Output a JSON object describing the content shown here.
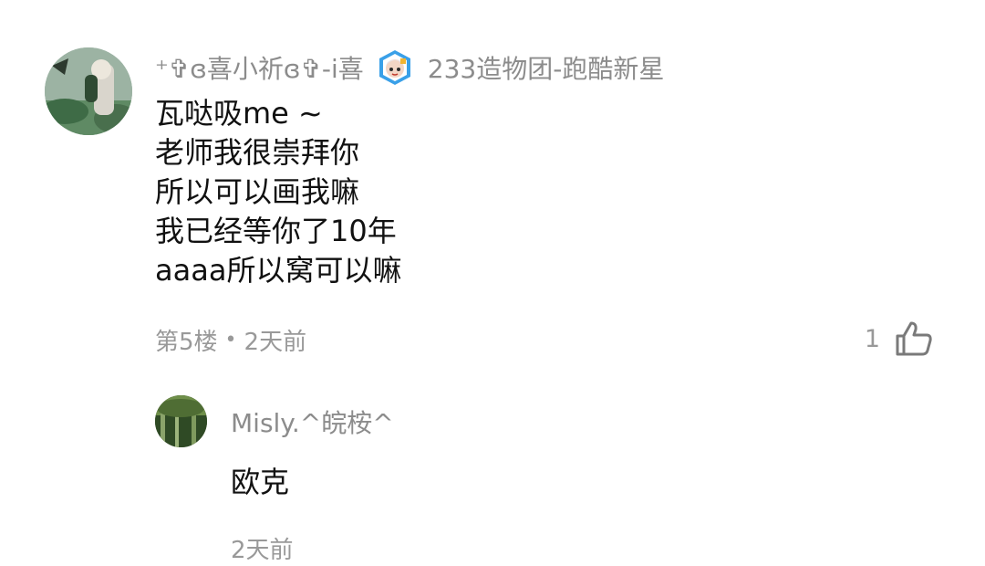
{
  "comment": {
    "user": {
      "name": "⁺✞ɞ喜小祈ɞ✞-i喜",
      "badge_icon": "team-badge-icon",
      "team": "233造物团-跑酷新星"
    },
    "lines": [
      "瓦哒吸me ~",
      "老师我很崇拜你",
      "所以可以画我嘛",
      "我已经等你了10年",
      "aaaa所以窝可以嘛"
    ],
    "floor": "第5楼",
    "separator": "•",
    "time": "2天前",
    "likes": "1",
    "like_icon": "thumbs-up-icon"
  },
  "reply": {
    "user": {
      "name": "Misly.^皖桉^"
    },
    "text": "欧克",
    "time": "2天前"
  },
  "colors": {
    "secondary_text": "#999999",
    "primary_text": "#111111",
    "badge_blue": "#3aa0e8"
  }
}
